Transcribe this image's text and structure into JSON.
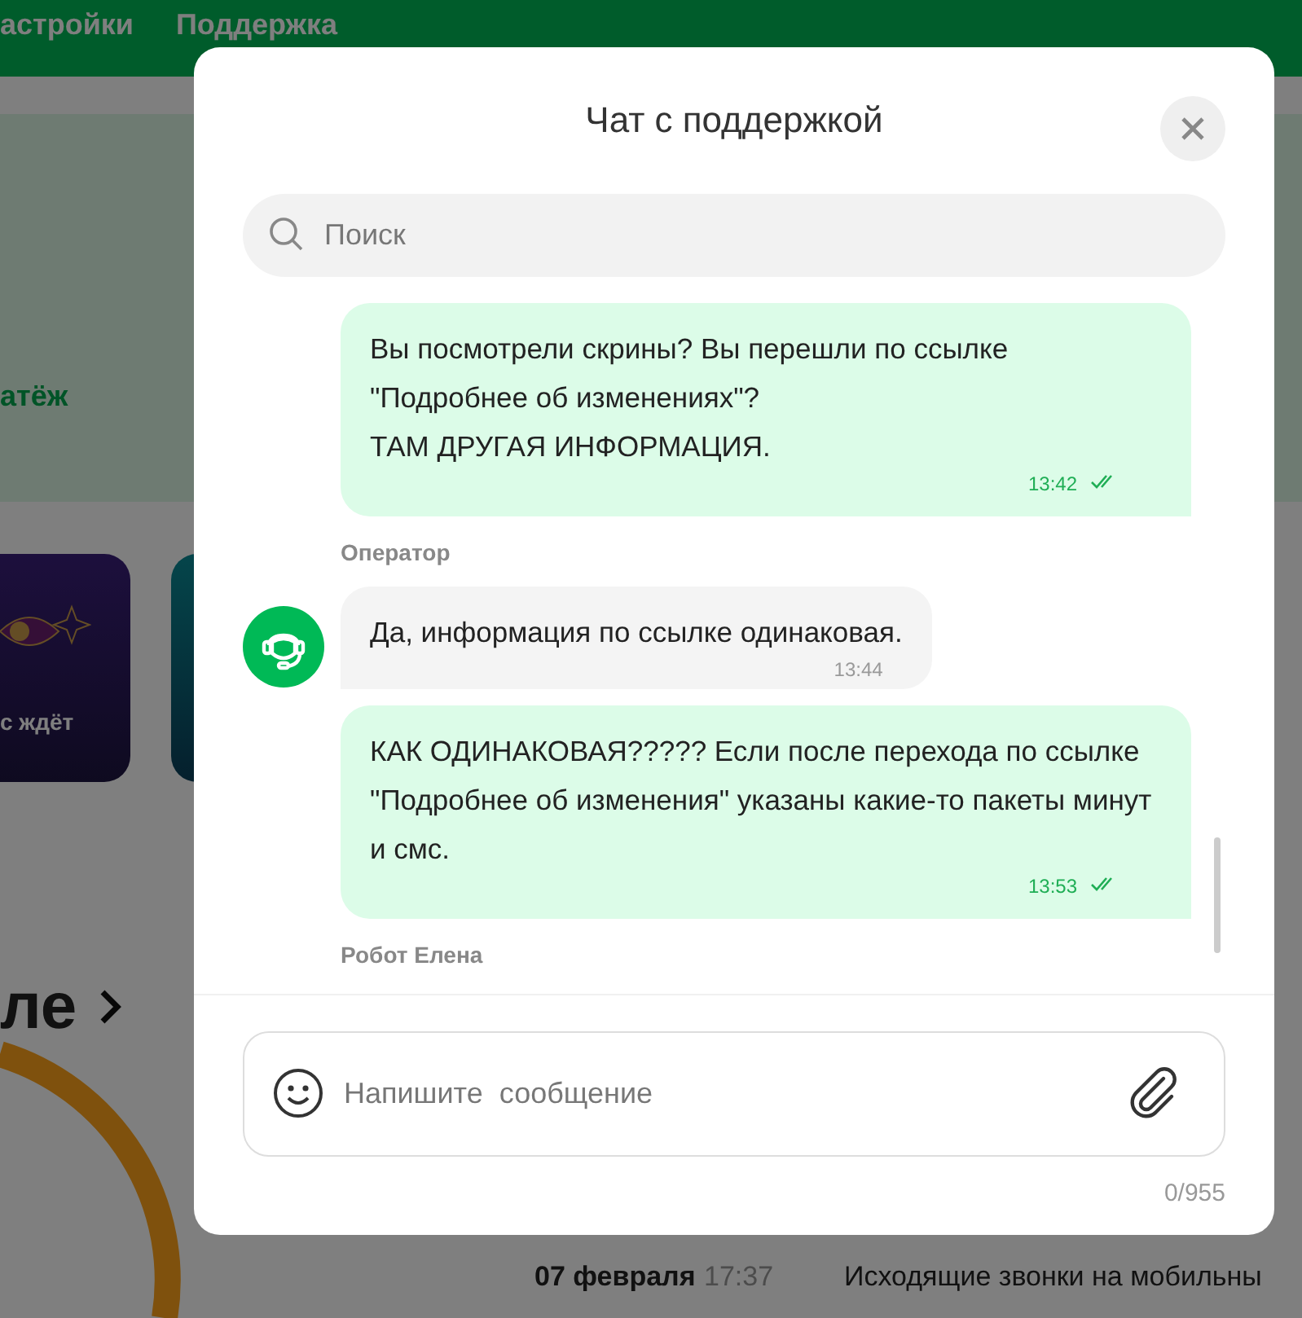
{
  "background": {
    "nav_items": [
      "астройки",
      "Поддержка"
    ],
    "payment_link": "атёж",
    "promo_cards": [
      {
        "kind": "eye",
        "caption": "с ждёт"
      },
      {
        "kind": "teal"
      }
    ],
    "section_title": "ле",
    "history_rows": [
      {
        "date": "07 февраля",
        "time": "17:37",
        "description": "Исходящие звонки на мобильны"
      }
    ]
  },
  "chat": {
    "title": "Чат с поддержкой",
    "search": {
      "placeholder": "Поиск"
    },
    "messages": [
      {
        "kind": "outgoing",
        "text": "Вы посмотрели скрины? Вы перешли по ссылке \"Подробнее об изменениях\"?\nТАМ ДРУГАЯ ИНФОРМАЦИЯ.",
        "time": "13:42",
        "read": true
      },
      {
        "kind": "sender",
        "text": "Оператор"
      },
      {
        "kind": "incoming",
        "text": "Да, информация по ссылке одинаковая.",
        "time": "13:44"
      },
      {
        "kind": "outgoing",
        "text": "КАК ОДИНАКОВАЯ????? Если после перехода по ссылке \"Подробнее об изменения\" указаны какие-то пакеты минут и смс.",
        "time": "13:53",
        "read": true
      },
      {
        "kind": "sender",
        "text": "Робот Елена"
      }
    ],
    "composer": {
      "placeholder": "Напишите  сообщение"
    },
    "counter": "0/955"
  }
}
